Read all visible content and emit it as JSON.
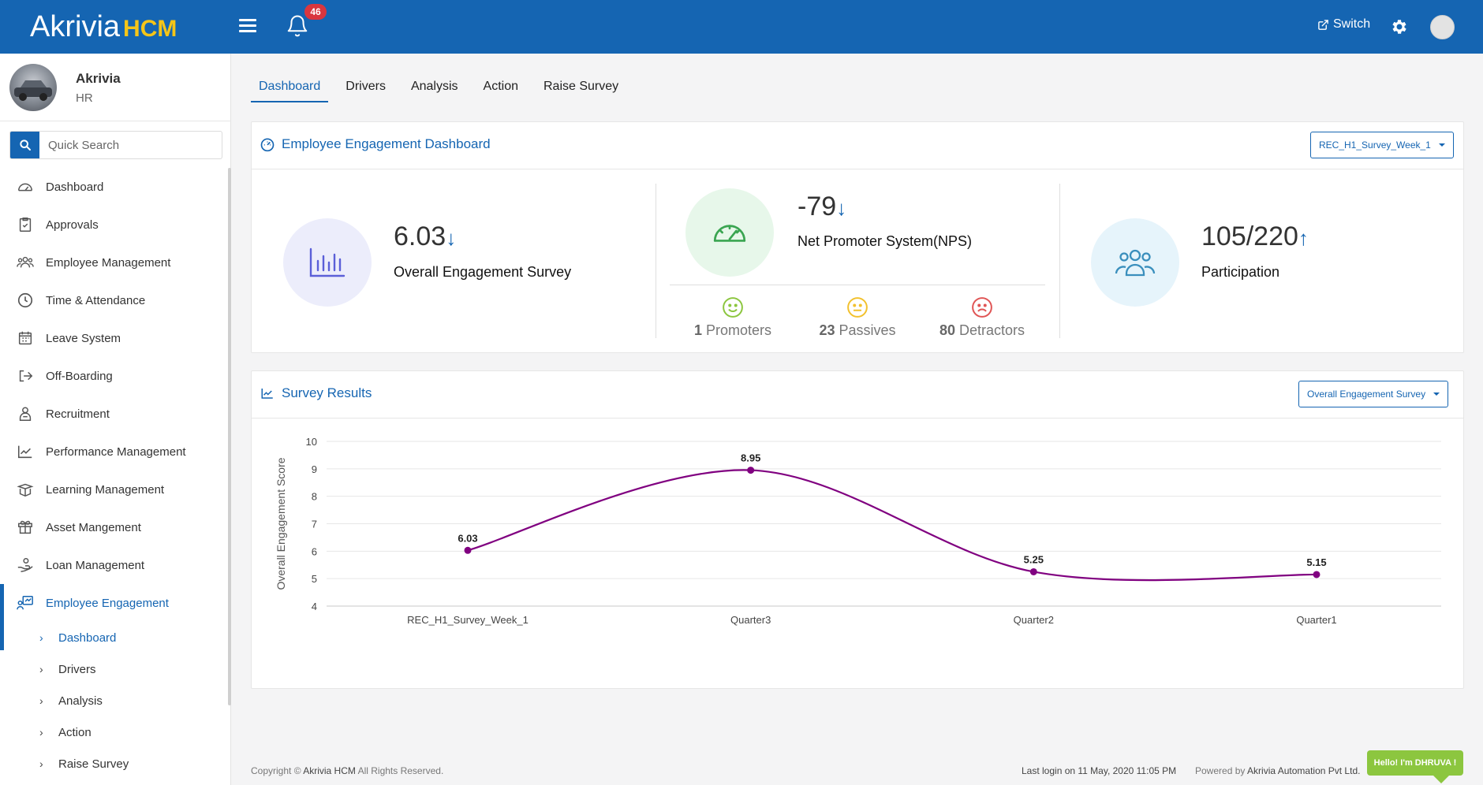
{
  "app": {
    "logo_main": "Akrivia",
    "logo_sub": "HCM",
    "notification_count": "46",
    "switch_label": "Switch"
  },
  "profile": {
    "name": "Akrivia",
    "role": "HR"
  },
  "search": {
    "placeholder": "Quick Search"
  },
  "sidebar": {
    "items": [
      {
        "label": "Dashboard",
        "icon": "dashboard-icon"
      },
      {
        "label": "Approvals",
        "icon": "clipboard-check-icon"
      },
      {
        "label": "Employee Management",
        "icon": "users-icon"
      },
      {
        "label": "Time & Attendance",
        "icon": "clock-icon"
      },
      {
        "label": "Leave System",
        "icon": "calendar-icon"
      },
      {
        "label": "Off-Boarding",
        "icon": "exit-icon"
      },
      {
        "label": "Recruitment",
        "icon": "recruitment-icon"
      },
      {
        "label": "Performance Management",
        "icon": "trend-chart-icon"
      },
      {
        "label": "Learning Management",
        "icon": "book-icon"
      },
      {
        "label": "Asset Mangement",
        "icon": "box-icon"
      },
      {
        "label": "Loan Management",
        "icon": "hand-money-icon"
      },
      {
        "label": "Employee Engagement",
        "icon": "engagement-icon"
      }
    ],
    "sub_items": [
      {
        "label": "Dashboard"
      },
      {
        "label": "Drivers"
      },
      {
        "label": "Analysis"
      },
      {
        "label": "Action"
      },
      {
        "label": "Raise Survey"
      }
    ]
  },
  "tabs": [
    {
      "label": "Dashboard"
    },
    {
      "label": "Drivers"
    },
    {
      "label": "Analysis"
    },
    {
      "label": "Action"
    },
    {
      "label": "Raise Survey"
    }
  ],
  "engagement_card": {
    "title": "Employee Engagement Dashboard",
    "dropdown_value": "REC_H1_Survey_Week_1",
    "overall": {
      "value": "6.03",
      "label": "Overall Engagement Survey",
      "trend": "down"
    },
    "nps": {
      "value": "-79",
      "label": "Net Promoter System(NPS)",
      "trend": "down",
      "promoters": {
        "count": "1",
        "label": "Promoters",
        "color": "#8cc63f"
      },
      "passives": {
        "count": "23",
        "label": "Passives",
        "color": "#f2c12e"
      },
      "detractors": {
        "count": "80",
        "label": "Detractors",
        "color": "#e05555"
      }
    },
    "participation": {
      "value": "105/220",
      "label": "Participation",
      "trend": "up"
    }
  },
  "results_card": {
    "title": "Survey Results",
    "dropdown_value": "Overall Engagement Survey"
  },
  "chart_data": {
    "type": "line",
    "categories": [
      "REC_H1_Survey_Week_1",
      "Quarter3",
      "Quarter2",
      "Quarter1"
    ],
    "series": [
      {
        "values": [
          6.03,
          8.95,
          5.25,
          5.15
        ],
        "color": "#800080"
      }
    ],
    "data_labels": [
      "6.03",
      "8.95",
      "5.25",
      "5.15"
    ],
    "ylabel": "Overall Engagement Score",
    "xlabel": "",
    "ylim": [
      4,
      10
    ],
    "yticks": [
      4,
      5,
      6,
      7,
      8,
      9,
      10
    ],
    "smooth": true,
    "grid": true
  },
  "footer": {
    "copyright_prefix": "Copyright ©",
    "copyright_brand": "Akrivia HCM",
    "copyright_suffix": "All Rights Reserved.",
    "last_login": "Last login on 11 May, 2020 11:05 PM",
    "powered_prefix": "Powered by",
    "powered_by": "Akrivia Automation Pvt Ltd."
  },
  "chat": {
    "label": "Hello! I'm DHRUVA !"
  },
  "colors": {
    "brand": "#1565b2",
    "accent_logo": "#f5c518",
    "line": "#800080"
  }
}
